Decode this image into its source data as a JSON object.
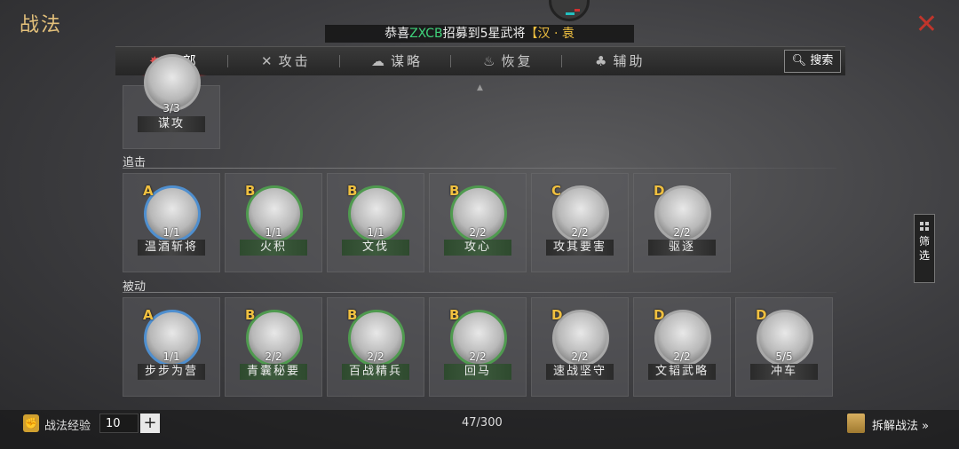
{
  "header": {
    "title": "战法",
    "announcement": {
      "prefix": "恭喜",
      "player": "ZXCB",
      "middle": "招募到5星武将",
      "general": "【汉 · 袁"
    }
  },
  "tabs": [
    {
      "label": "全部",
      "icon": "flag-icon",
      "glyph": "✸",
      "active": true
    },
    {
      "label": "攻击",
      "icon": "crossed-swords-icon",
      "glyph": "✕",
      "active": false
    },
    {
      "label": "谋略",
      "icon": "scroll-icon",
      "glyph": "☁",
      "active": false
    },
    {
      "label": "恢复",
      "icon": "pot-icon",
      "glyph": "♨",
      "active": false
    },
    {
      "label": "辅助",
      "icon": "bag-icon",
      "glyph": "♣",
      "active": false
    }
  ],
  "search_label": "搜索",
  "filter_label": "筛选",
  "sections": {
    "top_partial": {
      "cards": [
        {
          "count": "3/3",
          "name": "谋攻"
        }
      ]
    },
    "pursuit": {
      "label": "追击",
      "cards": [
        {
          "grade": "A",
          "count": "1/1",
          "name": "温酒斩将"
        },
        {
          "grade": "B",
          "count": "1/1",
          "name": "火积"
        },
        {
          "grade": "B",
          "count": "1/1",
          "name": "文伐"
        },
        {
          "grade": "B",
          "count": "2/2",
          "name": "攻心"
        },
        {
          "grade": "C",
          "count": "2/2",
          "name": "攻其要害"
        },
        {
          "grade": "D",
          "count": "2/2",
          "name": "驱逐"
        }
      ]
    },
    "passive": {
      "label": "被动",
      "cards": [
        {
          "grade": "A",
          "count": "1/1",
          "name": "步步为营"
        },
        {
          "grade": "B",
          "count": "2/2",
          "name": "青囊秘要"
        },
        {
          "grade": "B",
          "count": "2/2",
          "name": "百战精兵"
        },
        {
          "grade": "B",
          "count": "2/2",
          "name": "回马"
        },
        {
          "grade": "D",
          "count": "2/2",
          "name": "速战坚守"
        },
        {
          "grade": "D",
          "count": "2/2",
          "name": "文韬武略"
        },
        {
          "grade": "D",
          "count": "5/5",
          "name": "冲车"
        }
      ]
    }
  },
  "footer": {
    "exp_label": "战法经验",
    "exp_value": "10",
    "plus_label": "+",
    "page": "47/300",
    "dismantle_label": "拆解战法 »"
  },
  "colors": {
    "title_gold": "#e3c07a",
    "close_red": "#c0352b",
    "grade_gold": "#f0c040",
    "player_green": "#3fd27a"
  }
}
